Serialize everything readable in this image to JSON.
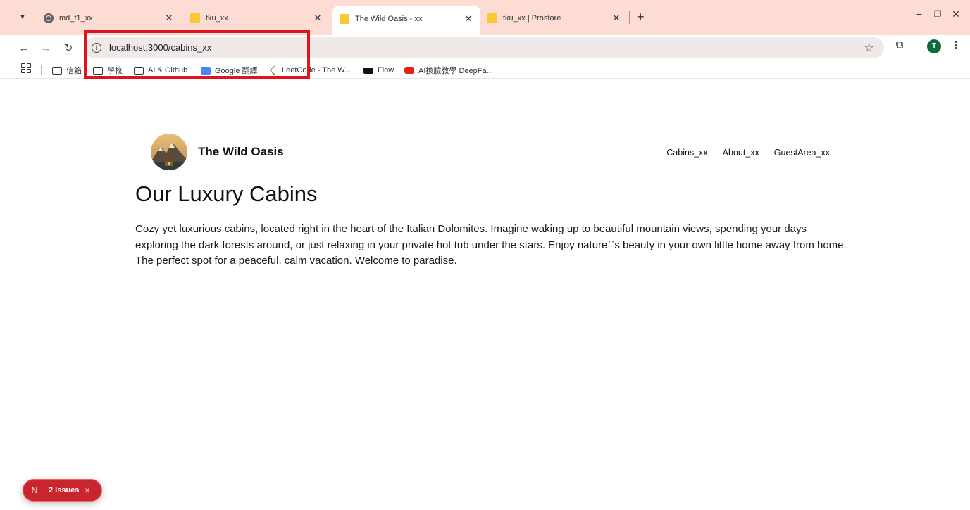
{
  "browser": {
    "tabs": [
      {
        "title": "md_f1_xx",
        "icon": "globe-icon",
        "active": false
      },
      {
        "title": "tku_xx",
        "icon": "folder-icon",
        "active": false
      },
      {
        "title": "The Wild Oasis - xx",
        "icon": "folder-icon",
        "active": true
      },
      {
        "title": "tku_xx | Prostore",
        "icon": "folder-icon",
        "active": false
      }
    ],
    "new_tab_label": "+",
    "url": "localhost:3000/cabins_xx",
    "profile_initial": "T",
    "bookmarks": [
      {
        "label": "信箱",
        "icon": "folder-icon"
      },
      {
        "label": "學校",
        "icon": "folder-icon"
      },
      {
        "label": "AI & Github",
        "icon": "folder-icon"
      },
      {
        "label": "Google 翻譯",
        "icon": "google-translate-icon"
      },
      {
        "label": "LeetCode - The W...",
        "icon": "leetcode-icon"
      },
      {
        "label": "Flow",
        "icon": "flow-icon"
      },
      {
        "label": "AI換臉教學 DeepFa...",
        "icon": "youtube-icon"
      }
    ],
    "accent_color": "#fcdcd3",
    "highlight_color": "#e0141e"
  },
  "site": {
    "brand": "The Wild Oasis",
    "nav": [
      "Cabins_xx",
      "About_xx",
      "GuestArea_xx"
    ]
  },
  "main": {
    "title": "Our Luxury Cabins",
    "intro": "Cozy yet luxurious cabins, located right in the heart of the Italian Dolomites. Imagine waking up to beautiful mountain views, spending your days exploring the dark forests around, or just relaxing in your private hot tub under the stars. Enjoy nature``s beauty in your own little home away from home. The perfect spot for a peaceful, calm vacation. Welcome to paradise."
  },
  "devtools": {
    "badge_letter": "N",
    "issues_label": "2 Issues",
    "close_label": "×"
  }
}
